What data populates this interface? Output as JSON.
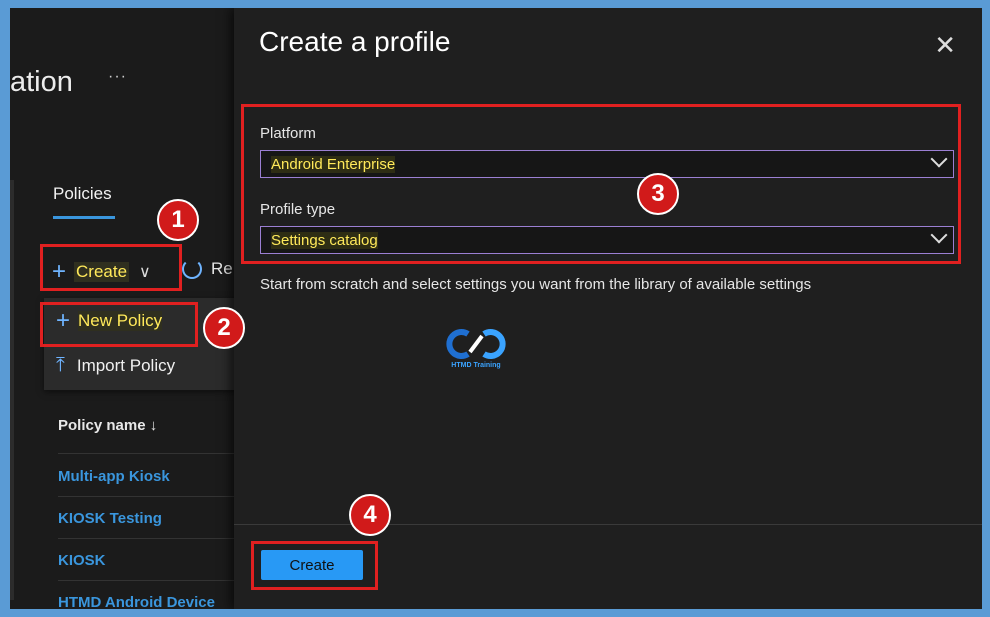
{
  "background": {
    "title_fragment": "ation",
    "more_ellipsis": "···",
    "tab": "Policies",
    "toolbar": {
      "create_label": "Create",
      "refresh_label": "Re"
    },
    "menu": {
      "new_policy": "New Policy",
      "import_policy": "Import Policy"
    },
    "table": {
      "column_header": "Policy name ↓",
      "rows": [
        "Multi-app Kiosk",
        "KIOSK Testing",
        "KIOSK",
        "HTMD Android Device"
      ]
    }
  },
  "panel": {
    "title": "Create a profile",
    "close_icon": "close-icon",
    "platform": {
      "label": "Platform",
      "value": "Android Enterprise"
    },
    "profile_type": {
      "label": "Profile type",
      "value": "Settings catalog"
    },
    "description": "Start from scratch and select settings you want from the library of available settings",
    "logo_text": "HTMD Training",
    "create_button": "Create"
  },
  "annotations": [
    "1",
    "2",
    "3",
    "4"
  ],
  "colors": {
    "accent": "#2899f5",
    "highlight": "#ffe95a",
    "annotation": "#e02020",
    "link": "#3a96dd"
  }
}
